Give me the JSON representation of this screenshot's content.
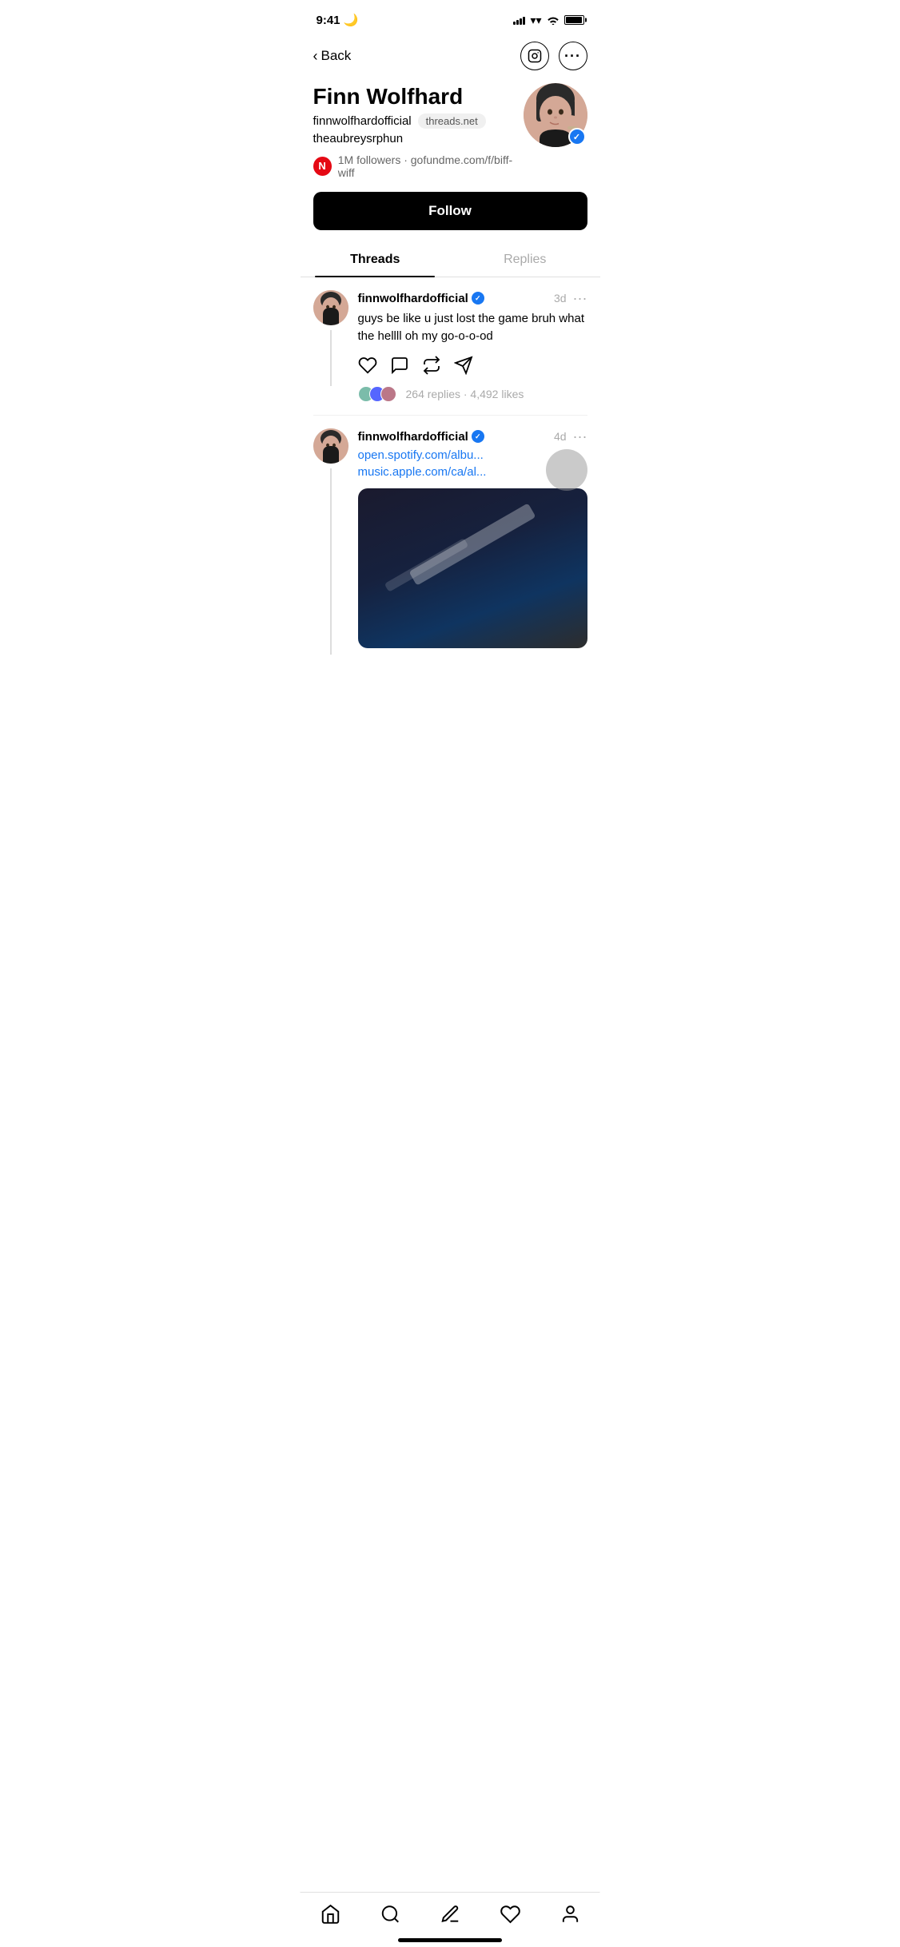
{
  "statusBar": {
    "time": "9:41",
    "moonIcon": "🌙"
  },
  "nav": {
    "backLabel": "Back",
    "instagramIcon": "📷",
    "moreIcon": "•••"
  },
  "profile": {
    "name": "Finn Wolfhard",
    "handle": "finnwolfhardofficial",
    "threadsBadge": "threads.net",
    "altHandle": "theaubreysrphun",
    "followersText": "1M followers · gofundme.com/f/biff-wiff",
    "followLabel": "Follow"
  },
  "tabs": {
    "threads": "Threads",
    "replies": "Replies"
  },
  "posts": [
    {
      "username": "finnwolfhardofficial",
      "verified": true,
      "time": "3d",
      "content": "guys be like u just lost the game bruh what the hellll oh my go-o-o-od",
      "replies": "264 replies · 4,492 likes"
    },
    {
      "username": "finnwolfhardofficial",
      "verified": true,
      "time": "4d",
      "link1": "open.spotify.com/albu...",
      "link2": "music.apple.com/ca/al...",
      "hasImage": true
    }
  ],
  "bottomNav": {
    "home": "⌂",
    "search": "🔍",
    "compose": "✏",
    "activity": "♡",
    "profile": "👤"
  }
}
